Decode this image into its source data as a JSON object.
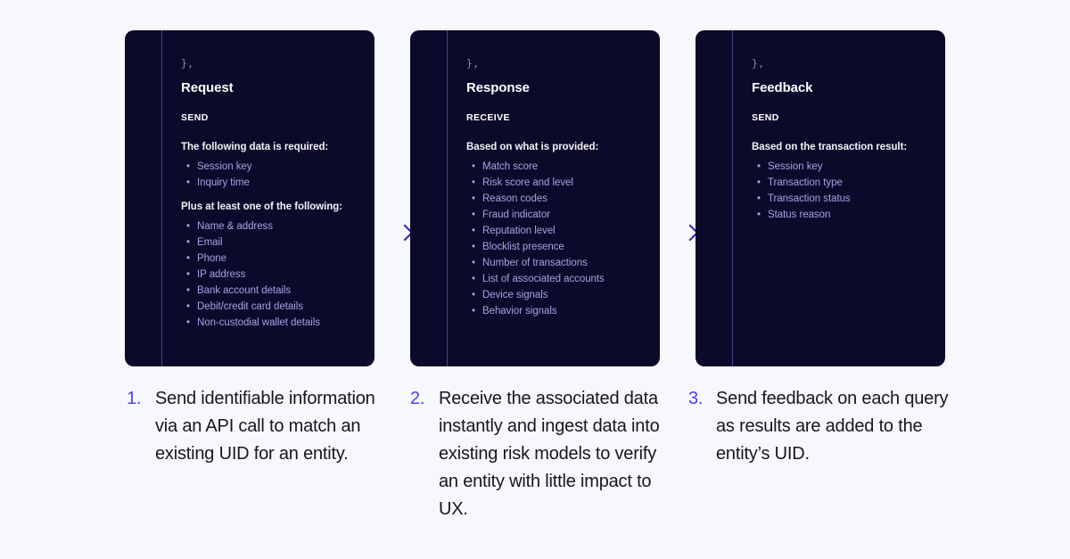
{
  "theme": {
    "page_background": "#f7f8fd",
    "card_background": "#0c0a2a",
    "card_rail": "#4c4384",
    "list_item_color": "#a8a1e6",
    "heading_color": "#ffffff",
    "caption_number_color": "#4b3ff0",
    "caption_text_color": "#16161d",
    "arrow_color": "#3a2fd6"
  },
  "cards": [
    {
      "brace": "},",
      "title": "Request",
      "method": "SEND",
      "sections": [
        {
          "lead": "The following data is required:",
          "items": [
            "Session key",
            "Inquiry time"
          ]
        },
        {
          "lead": "Plus at least one of the following:",
          "items": [
            "Name & address",
            "Email",
            "Phone",
            "IP address",
            "Bank account details",
            "Debit/credit card details",
            "Non-custodial wallet details"
          ]
        }
      ]
    },
    {
      "brace": "},",
      "title": "Response",
      "method": "RECEIVE",
      "sections": [
        {
          "lead": "Based on what is provided:",
          "items": [
            "Match score",
            "Risk score and level",
            "Reason codes",
            "Fraud indicator",
            "Reputation level",
            "Blocklist presence",
            "Number of transactions",
            "List of associated accounts",
            "Device signals",
            "Behavior signals"
          ]
        }
      ]
    },
    {
      "brace": "},",
      "title": "Feedback",
      "method": "SEND",
      "sections": [
        {
          "lead": "Based on the transaction result:",
          "items": [
            "Session key",
            "Transaction type",
            "Transaction status",
            "Status reason"
          ]
        }
      ]
    }
  ],
  "arrows": [
    {
      "name": "arrow-request-to-response",
      "direction": "right"
    },
    {
      "name": "arrow-response-to-feedback",
      "direction": "right"
    }
  ],
  "captions": [
    {
      "number": "1.",
      "text": "Send identifiable information via an API call to match an existing UID for an entity."
    },
    {
      "number": "2.",
      "text": "Receive the associated data instantly and ingest data into existing risk models to verify an entity with little impact to UX."
    },
    {
      "number": "3.",
      "text": "Send feedback on each query as results are added to the entity’s UID."
    }
  ],
  "bullet_glyph": "•"
}
